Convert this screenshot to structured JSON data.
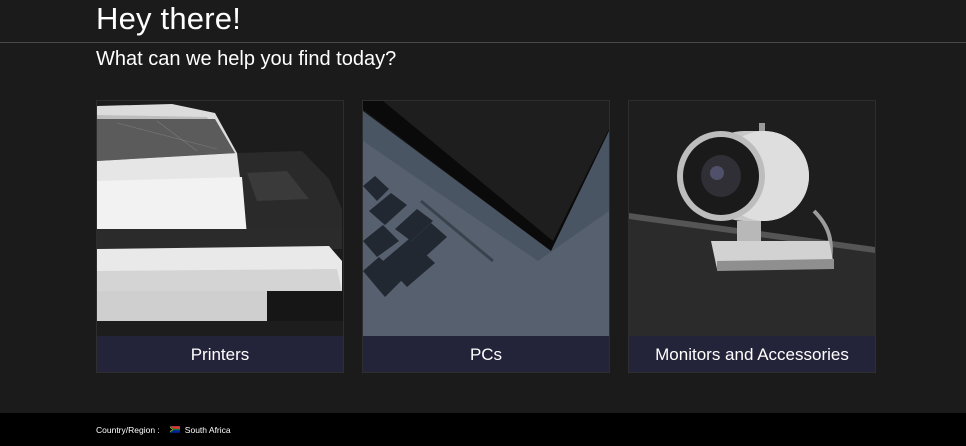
{
  "hero": {
    "title": "Hey there!",
    "subtitle": "What can we help you find today?"
  },
  "categories": [
    {
      "label": "Printers",
      "image": "printer-photo"
    },
    {
      "label": "PCs",
      "image": "laptop-photo"
    },
    {
      "label": "Monitors and Accessories",
      "image": "webcam-photo"
    }
  ],
  "footer": {
    "region_label": "Country/Region :",
    "region_value": "South Africa",
    "flag_icon": "south-africa-flag-icon"
  },
  "colors": {
    "background": "#1b1b1b",
    "card_label_bg": "#23233a",
    "footer_bg": "#000000"
  }
}
